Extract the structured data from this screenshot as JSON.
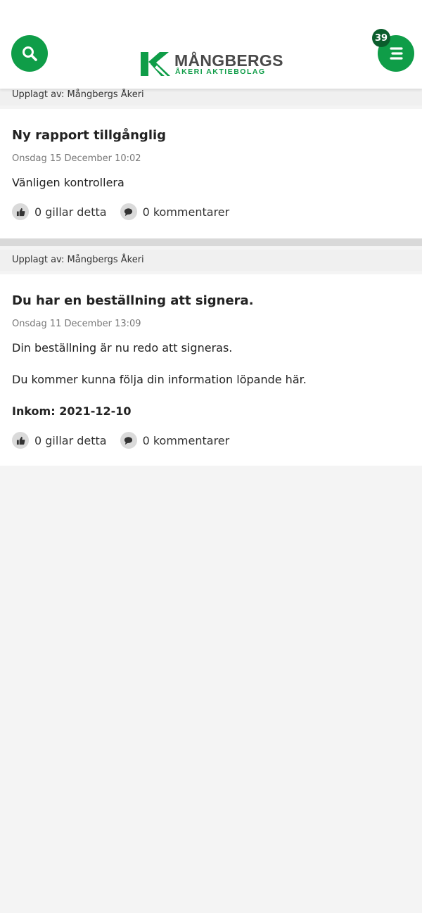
{
  "header": {
    "badge_count": "39",
    "logo": {
      "name": "MÅNGBERGS",
      "subtitle": "ÅKERI AKTIEBOLAG"
    },
    "brand_color": "#0f9d48"
  },
  "posts": [
    {
      "posted_by": "Upplagt av: Mångbergs Åkeri",
      "title": "Ny rapport tillgånglig",
      "date": "Onsdag 15 December 10:02",
      "body": [
        "Vänligen kontrollera"
      ],
      "likes": "0 gillar detta",
      "comments": "0 kommentarer"
    },
    {
      "posted_by": "Upplagt av: Mångbergs Åkeri",
      "title": "Du har en beställning att signera.",
      "date": "Onsdag 11 December 13:09",
      "body": [
        "Din beställning är nu redo att signeras.",
        "Du kommer kunna följa din information löpande här."
      ],
      "bold_line": "Inkom: 2021-12-10",
      "likes": "0 gillar detta",
      "comments": "0 kommentarer"
    }
  ]
}
